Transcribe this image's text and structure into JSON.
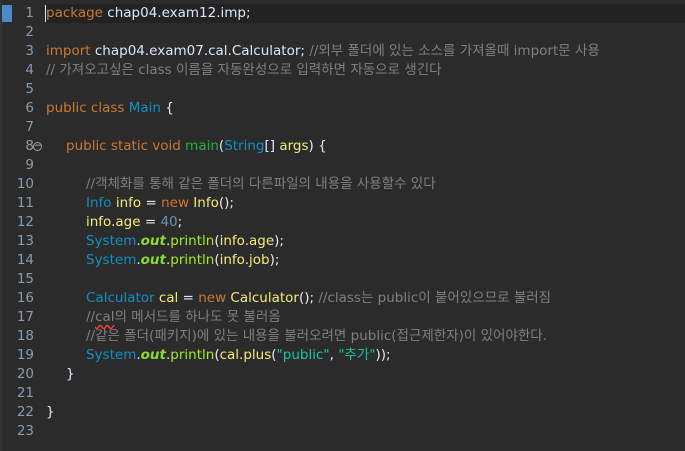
{
  "editor": {
    "line_numbers": [
      "1",
      "2",
      "3",
      "4",
      "5",
      "6",
      "7",
      "8",
      "9",
      "10",
      "11",
      "12",
      "13",
      "14",
      "15",
      "16",
      "17",
      "18",
      "19",
      "20",
      "21",
      "22",
      "23"
    ],
    "lines": {
      "l1": {
        "kw": "package",
        "rest": " chap04.exam12.imp;"
      },
      "l3": {
        "kw": "import",
        "rest": " chap04.exam07.cal.Calculator; ",
        "cmt": "//외부 폴더에 있는 소스를 가져올때 import문 사용"
      },
      "l4": {
        "cmt": "// 가져오고싶은 class 이름을 자동완성으로 입력하면 자동으로 생긴다"
      },
      "l6": {
        "kw1": "public",
        "kw2": "class",
        "cls": "Main",
        "rest": " {"
      },
      "l8": {
        "kw1": "public",
        "kw2": "static",
        "kw3": "void",
        "name": "main",
        "p1": "(",
        "type": "String",
        "p2": "[] ",
        "arg": "args",
        "p3": ") {"
      },
      "l10": {
        "cmt": "//객체화를 통해 같은 폴더의 다른파일의 내용을 사용할수 있다"
      },
      "l11": {
        "type": "Info",
        "var": "info",
        "eq": " = ",
        "kw": "new",
        "call": "Info",
        "end": "();"
      },
      "l12": {
        "obj": "info",
        "dot": ".",
        "fld": "age",
        "eq": " = ",
        "num": "40",
        "end": ";"
      },
      "l13": {
        "sys": "System",
        "dot1": ".",
        "out": "out",
        "dot2": ".",
        "method": "println",
        "p1": "(",
        "obj": "info",
        "dot3": ".",
        "fld": "age",
        "end": ");"
      },
      "l14": {
        "sys": "System",
        "dot1": ".",
        "out": "out",
        "dot2": ".",
        "method": "println",
        "p1": "(",
        "obj": "info",
        "dot3": ".",
        "fld": "job",
        "end": ");"
      },
      "l16": {
        "type": "Calculator",
        "var": "cal",
        "eq": " = ",
        "kw": "new",
        "call": "Calculator",
        "end": "(); ",
        "cmt": "//class는 public이 붙어있으므로 불러짐"
      },
      "l17": {
        "cmt_a": "//",
        "cmt_b": "cal",
        "cmt_c": "의 메서드를 하나도 못 불러옴"
      },
      "l18": {
        "cmt": "//같은 폴더(패키지)에 있는 내용을 불러오려면 public(접근제한자)이 있어야한다."
      },
      "l19": {
        "sys": "System",
        "dot1": ".",
        "out": "out",
        "dot2": ".",
        "method": "println",
        "p1": "(",
        "obj": "cal",
        "dot3": ".",
        "call": "plus",
        "p2": "(",
        "s1": "\"public\"",
        "comma": ", ",
        "s2": "\"추가\"",
        "end": "));"
      },
      "l20": {
        "text": "}"
      },
      "l22": {
        "text": "}"
      }
    },
    "fold_marker_line": "8",
    "fold_icon": "minus-circle-icon"
  }
}
